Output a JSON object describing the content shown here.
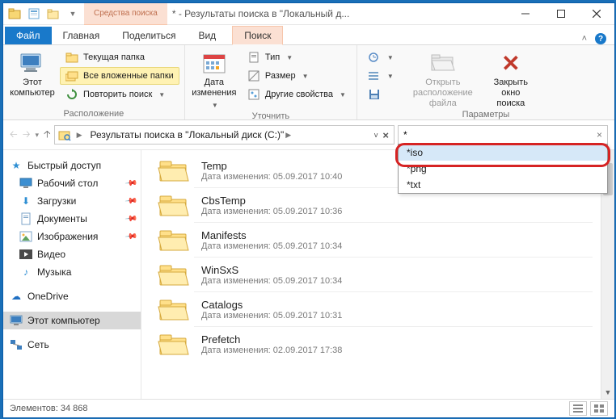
{
  "title": "* - Результаты поиска в \"Локальный д...",
  "context_tab_header": "Средства поиска",
  "tabs": {
    "file": "Файл",
    "home": "Главная",
    "share": "Поделиться",
    "view": "Вид",
    "search": "Поиск"
  },
  "ribbon": {
    "group1": {
      "this_pc": "Этот\nкомпьютер",
      "current_folder": "Текущая папка",
      "all_subfolders": "Все вложенные папки",
      "repeat_search": "Повторить поиск",
      "label": "Расположение"
    },
    "group2": {
      "date": "Дата\nизменения",
      "type": "Тип",
      "size": "Размер",
      "other": "Другие свойства",
      "label": "Уточнить"
    },
    "group3": {
      "recent": "",
      "advanced": "",
      "save": "",
      "open_location": "Открыть\nрасположение файла",
      "close_search": "Закрыть\nокно поиска",
      "label": "Параметры"
    }
  },
  "breadcrumb": "Результаты поиска в \"Локальный диск (C:)\"",
  "search_value": "*",
  "suggestions": [
    "*iso",
    "*png",
    "*txt"
  ],
  "nav": {
    "quick": "Быстрый доступ",
    "desktop": "Рабочий стол",
    "downloads": "Загрузки",
    "documents": "Документы",
    "pictures": "Изображения",
    "videos": "Видео",
    "music": "Музыка",
    "onedrive": "OneDrive",
    "this_pc": "Этот компьютер",
    "network": "Сеть"
  },
  "items": [
    {
      "name": "Temp",
      "meta": "Дата изменения: 05.09.2017 10:40"
    },
    {
      "name": "CbsTemp",
      "meta": "Дата изменения: 05.09.2017 10:36"
    },
    {
      "name": "Manifests",
      "meta": "Дата изменения: 05.09.2017 10:34"
    },
    {
      "name": "WinSxS",
      "meta": "Дата изменения: 05.09.2017 10:34"
    },
    {
      "name": "Catalogs",
      "meta": "Дата изменения: 05.09.2017 10:31"
    },
    {
      "name": "Prefetch",
      "meta": "Дата изменения: 02.09.2017 17:38"
    }
  ],
  "status": "Элементов: 34 868"
}
